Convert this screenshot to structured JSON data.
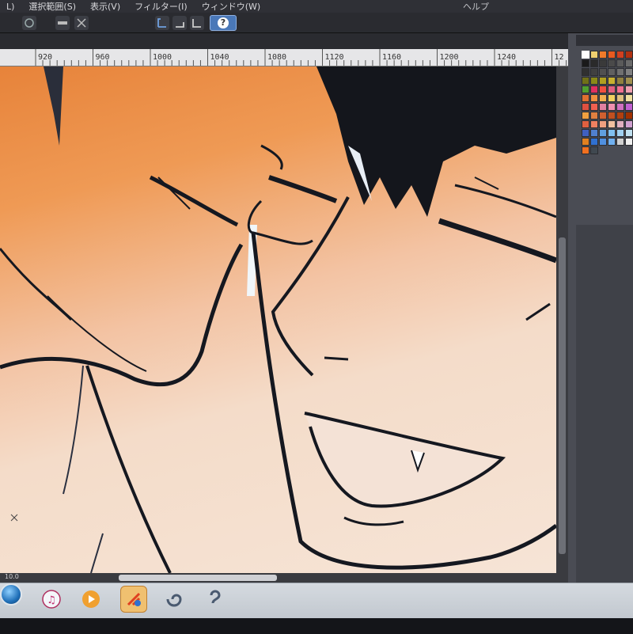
{
  "menubar": {
    "items": [
      "L)",
      "選択範囲(S)",
      "表示(V)",
      "フィルター(I)",
      "ウィンドウ(W)"
    ],
    "right_label": "ヘルプ"
  },
  "toolbar": {
    "help_label": "?"
  },
  "ruler": {
    "ticks": [
      "920",
      "960",
      "1000",
      "1040",
      "1080",
      "1120",
      "1160",
      "1200",
      "1240",
      "12"
    ]
  },
  "statusbar": {
    "zoom": "10.0"
  },
  "palette": {
    "colors": [
      "#ffffff",
      "#f0d070",
      "#f07a2a",
      "#e85a20",
      "#d04020",
      "#b03010",
      "#1a1a1a",
      "#2a2a2a",
      "#3a3a3a",
      "#4a4a4a",
      "#5a5a5a",
      "#6a6a6a",
      "#303030",
      "#404040",
      "#505050",
      "#606060",
      "#707070",
      "#808080",
      "#707018",
      "#8a8a18",
      "#b0a020",
      "#c8b030",
      "#908040",
      "#a09050",
      "#50a030",
      "#e03060",
      "#f05040",
      "#e06080",
      "#f07090",
      "#f0a0b0",
      "#e07030",
      "#f09040",
      "#f0b050",
      "#f0d060",
      "#e0c080",
      "#f0e0a0",
      "#e05040",
      "#f06050",
      "#e080a0",
      "#f090b0",
      "#d070c0",
      "#c060d0",
      "#f0a040",
      "#e08040",
      "#d06030",
      "#c05020",
      "#b04010",
      "#a03000",
      "#e06040",
      "#f08060",
      "#f0a080",
      "#f0c0a0",
      "#e0b0c0",
      "#d0a0d0",
      "#4060c0",
      "#5080d0",
      "#60a0e0",
      "#80c0f0",
      "#a0d0f0",
      "#c0e0f0",
      "#e08020",
      "#3070d0",
      "#5090e0",
      "#70b0f0",
      "#d0d0d0",
      "#f0f0f0",
      "#f07020",
      "#404850"
    ]
  },
  "taskbar": {
    "icons": [
      "start-orb",
      "itunes-icon",
      "media-player-icon",
      "clip-studio-icon",
      "clip-studio-paint-icon",
      "clip-studio-modeler-icon"
    ]
  }
}
